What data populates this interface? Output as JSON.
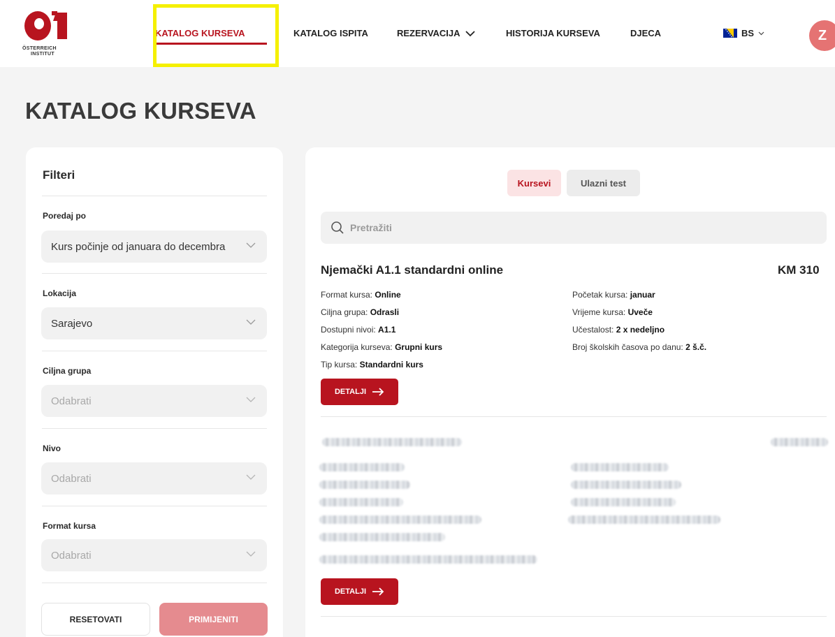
{
  "logo": {
    "text_line1": "ÖSTERREICH",
    "text_line2": "INSTITUT",
    "brand_color": "#b8141f"
  },
  "nav": {
    "items": [
      {
        "label": "KATALOG KURSEVA",
        "active": true
      },
      {
        "label": "KATALOG ISPITA"
      },
      {
        "label": "REZERVACIJA"
      },
      {
        "label": "HISTORIJA KURSEVA"
      },
      {
        "label": "DJECA"
      }
    ],
    "language": "BS",
    "avatar_initial": "Z"
  },
  "page_title": "KATALOG KURSEVA",
  "filters": {
    "title": "Filteri",
    "sort": {
      "label": "Poredaj po",
      "value": "Kurs počinje od januara do decembra"
    },
    "location": {
      "label": "Lokacija",
      "value": "Sarajevo"
    },
    "target_group": {
      "label": "Ciljna grupa",
      "placeholder": "Odabrati"
    },
    "level": {
      "label": "Nivo",
      "placeholder": "Odabrati"
    },
    "format": {
      "label": "Format kursa",
      "placeholder": "Odabrati"
    },
    "reset_label": "RESETOVATI",
    "apply_label": "PRIMIJENITI"
  },
  "main": {
    "tabs": [
      {
        "label": "Kursevi",
        "active": true
      },
      {
        "label": "Ulazni test"
      }
    ],
    "search_placeholder": "Pretražiti",
    "courses": [
      {
        "title": "Njemački A1.1 standardni online",
        "price": "KM 310",
        "left_attrs": [
          {
            "label": "Format kursa: ",
            "value": "Online"
          },
          {
            "label": "Ciljna grupa: ",
            "value": "Odrasli"
          },
          {
            "label": "Dostupni nivoi: ",
            "value": "A1.1"
          },
          {
            "label": "Kategorija kurseva: ",
            "value": "Grupni kurs"
          },
          {
            "label": "Tip kursa: ",
            "value": "Standardni kurs"
          }
        ],
        "right_attrs": [
          {
            "label": "Početak kursa: ",
            "value": "januar"
          },
          {
            "label": "Vrijeme kursa: ",
            "value": "Uveče"
          },
          {
            "label": "Učestalost: ",
            "value": "2 x nedeljno"
          },
          {
            "label": "Broj školskih časova po danu: ",
            "value": "2 š.č."
          }
        ],
        "details_label": "DETALJI"
      },
      {
        "details_label": "DETALJI"
      }
    ]
  }
}
